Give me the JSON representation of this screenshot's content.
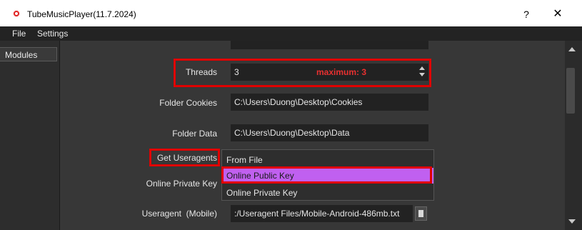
{
  "window": {
    "title": "TubeMusicPlayer(11.7.2024)",
    "help": "?",
    "close": "✕"
  },
  "menu": {
    "file": "File",
    "settings": "Settings"
  },
  "sidebar": {
    "modules": "Modules"
  },
  "threads": {
    "label": "Threads",
    "value": "3",
    "max_note": "maximum: 3"
  },
  "cookies": {
    "label": "Folder Cookies",
    "value": "C:\\Users\\Duong\\Desktop\\Cookies"
  },
  "data_folder": {
    "label": "Folder Data",
    "value": "C:\\Users\\Duong\\Desktop\\Data"
  },
  "useragents": {
    "label": "Get Useragents",
    "options": [
      "From File",
      "Online Public Key",
      "Online Private Key"
    ],
    "highlighted": "Online Public Key"
  },
  "private_key": {
    "label": "Online Private Key"
  },
  "useragent_mobile": {
    "label": "Useragent  (Mobile)",
    "value": ":/Useragent Files/Mobile-Android-486mb.txt"
  },
  "colors": {
    "highlight": "#c060f0",
    "annotation": "#e00000",
    "max_text": "#e83030"
  }
}
